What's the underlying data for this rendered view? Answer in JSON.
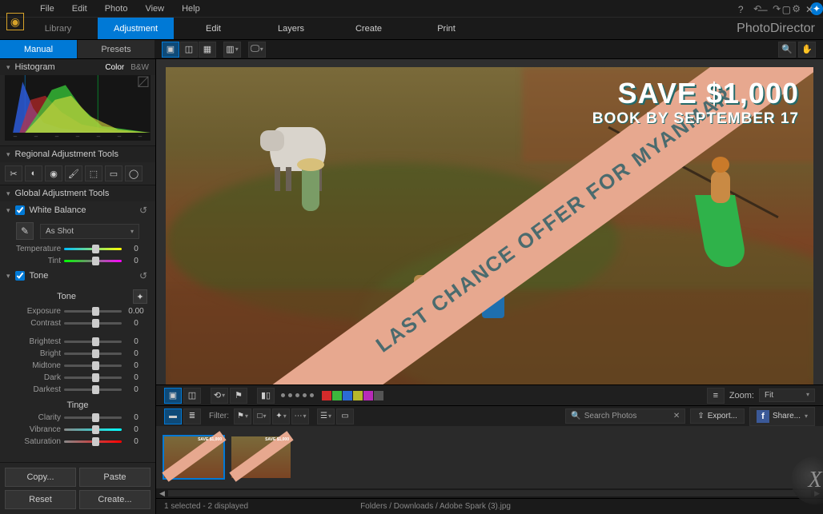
{
  "menu": {
    "items": [
      "File",
      "Edit",
      "Photo",
      "View",
      "Help"
    ]
  },
  "brand": "PhotoDirector",
  "main_tabs": [
    "Library",
    "Adjustment",
    "Edit",
    "Layers",
    "Create",
    "Print"
  ],
  "main_active": 1,
  "sub_tabs": [
    "Manual",
    "Presets"
  ],
  "sub_active": 0,
  "sidebar": {
    "histogram": {
      "title": "Histogram",
      "mode_color": "Color",
      "mode_bw": "B&W"
    },
    "regional": {
      "title": "Regional Adjustment Tools"
    },
    "global": {
      "title": "Global Adjustment Tools"
    },
    "white_balance": {
      "title": "White Balance",
      "preset": "As Shot",
      "temperature": {
        "label": "Temperature",
        "value": "0"
      },
      "tint": {
        "label": "Tint",
        "value": "0"
      }
    },
    "tone": {
      "title": "Tone",
      "heading": "Tone",
      "exposure": {
        "label": "Exposure",
        "value": "0.00"
      },
      "contrast": {
        "label": "Contrast",
        "value": "0"
      },
      "brightest": {
        "label": "Brightest",
        "value": "0"
      },
      "bright": {
        "label": "Bright",
        "value": "0"
      },
      "midtone": {
        "label": "Midtone",
        "value": "0"
      },
      "dark": {
        "label": "Dark",
        "value": "0"
      },
      "darkest": {
        "label": "Darkest",
        "value": "0"
      }
    },
    "tinge": {
      "heading": "Tinge",
      "clarity": {
        "label": "Clarity",
        "value": "0"
      },
      "vibrance": {
        "label": "Vibrance",
        "value": "0"
      },
      "saturation": {
        "label": "Saturation",
        "value": "0"
      }
    },
    "buttons": {
      "copy": "Copy...",
      "paste": "Paste",
      "reset": "Reset",
      "create": "Create..."
    }
  },
  "photo_overlay": {
    "banner": "LAST CHANCE OFFER FOR MYANMAR",
    "save": "SAVE $1,000",
    "book": "BOOK BY SEPTEMBER 17"
  },
  "bar1": {
    "zoom_label": "Zoom:",
    "zoom_value": "Fit",
    "swatches": [
      "#d52b2b",
      "#3db83d",
      "#2b6bd5",
      "#b8b82b",
      "#b82bb8",
      "#555555"
    ]
  },
  "bar2": {
    "filter_label": "Filter:",
    "search_placeholder": "Search Photos",
    "export": "Export...",
    "share": "Share..."
  },
  "status": {
    "selection": "1 selected - 2 displayed",
    "path": "Folders / Downloads / Adobe Spark (3).jpg"
  }
}
